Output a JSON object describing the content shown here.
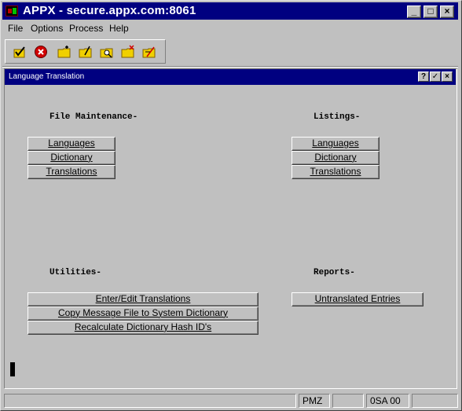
{
  "window": {
    "title": "APPX - secure.appx.com:8061",
    "minimize_glyph": "_",
    "maximize_glyph": "□",
    "close_glyph": "×"
  },
  "menu": [
    "File",
    "Options",
    "Process",
    "Help"
  ],
  "toolbar": {
    "icons": [
      "check-icon",
      "cancel-icon",
      "new-folder-icon",
      "edit-folder-icon",
      "search-folder-icon",
      "delete-folder-icon",
      "tools-folder-icon"
    ]
  },
  "child_window": {
    "title": "Language Translation",
    "help_glyph": "?",
    "ok_glyph": "✓",
    "close_glyph": "×"
  },
  "sections": {
    "file_maintenance": {
      "label": "File Maintenance-",
      "buttons": [
        "Languages",
        "Dictionary",
        "Translations"
      ]
    },
    "listings": {
      "label": "Listings-",
      "buttons": [
        "Languages",
        "Dictionary",
        "Translations"
      ]
    },
    "utilities": {
      "label": "Utilities-",
      "buttons": [
        "Enter/Edit Translations",
        "Copy Message File to System Dictionary",
        "Recalculate Dictionary Hash ID's"
      ]
    },
    "reports": {
      "label": "Reports-",
      "buttons": [
        "Untranslated Entries"
      ]
    }
  },
  "status_bar": {
    "panels": [
      "",
      "PMZ",
      "",
      "0SA 00",
      ""
    ]
  },
  "colors": {
    "titlebar": "#000080",
    "face": "#c0c0c0",
    "cancel": "#d00000",
    "folder": "#f0d000"
  }
}
